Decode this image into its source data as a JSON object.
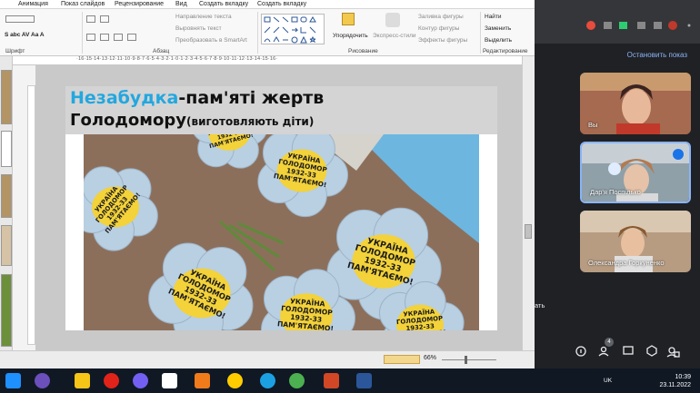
{
  "menu": [
    "Анимация",
    "Показ слайдов",
    "Рецензирование",
    "Вид",
    "Создать вкладку",
    "Создать вкладку"
  ],
  "ribbon": {
    "groups": {
      "font": "Шрифт",
      "paragraph": "Абзац",
      "drawing": "Рисование",
      "editing": "Редактирование"
    },
    "paragraph_buttons": {
      "direction": "Направление текста",
      "align": "Выровнять текст",
      "smartart": "Преобразовать в SmartArt"
    },
    "drawing_buttons": {
      "arrange": "Упорядочить",
      "express": "Экспресс-стили",
      "fill": "Заливка фигуры",
      "outline": "Контур фигуры",
      "effects": "Эффекты фигуры"
    },
    "editing_buttons": {
      "find": "Найти",
      "replace": "Заменить",
      "select": "Выделить"
    }
  },
  "ruler_text": "·16·15·14·13·12·11·10·9·8·7·6·5·4·3·2·1·0·1·2·3·4·5·6·7·8·9·10·11·12·13·14·15·16·",
  "slide": {
    "title_part1": "Незабудка",
    "title_part2": "-пам'яті  жертв",
    "title_line2": "Голодомору",
    "title_line2_small": "(виготовляють діти)",
    "flower_text": [
      "УКРАЇНА",
      "ГОЛОДОМОР",
      "1932-33",
      "ПАМ'ЯТАЄМО!"
    ]
  },
  "status": {
    "zoom": "66%"
  },
  "meet": {
    "present_button": "Остановить показ",
    "participants": [
      {
        "name": "Вы"
      },
      {
        "name": "Дар'я Поспілько"
      },
      {
        "name": "Олександра Горкуненко"
      }
    ],
    "participant_count": "4",
    "left_text": "ать"
  },
  "clock": {
    "time": "10:39",
    "date": "23.11.2022",
    "lang": "UK"
  },
  "colors": {
    "title_blue": "#23a7df",
    "present_blue": "#8ab4f8",
    "taskbar": "#101824"
  }
}
